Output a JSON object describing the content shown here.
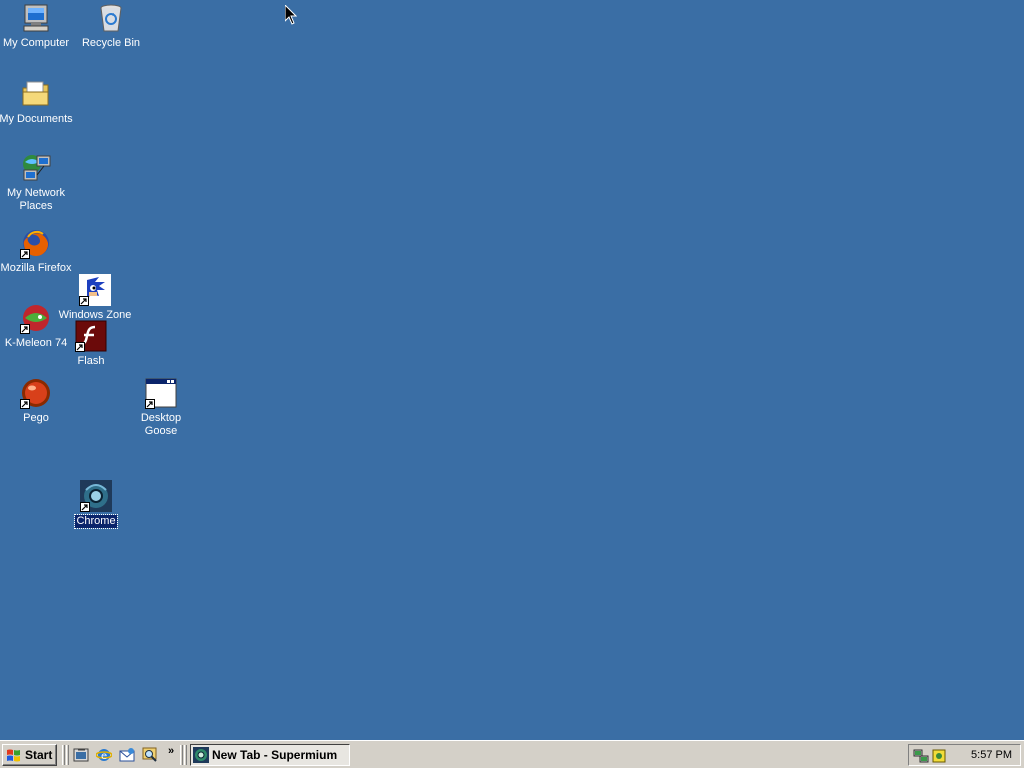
{
  "desktop": {
    "background": "#3a6ea5",
    "icons": [
      {
        "label": "My Computer",
        "icon": "computer-icon"
      },
      {
        "label": "Recycle Bin",
        "icon": "recycle-bin-icon"
      },
      {
        "label": "My Documents",
        "icon": "folder-icon"
      },
      {
        "label": "My Network Places",
        "icon": "network-icon"
      },
      {
        "label": "Mozilla Firefox",
        "icon": "firefox-icon"
      },
      {
        "label": "Windows Zone",
        "icon": "sonic-icon"
      },
      {
        "label": "K-Meleon 74",
        "icon": "k-meleon-icon"
      },
      {
        "label": "Flash",
        "icon": "flash-icon"
      },
      {
        "label": "Pego",
        "icon": "pego-icon"
      },
      {
        "label": "Desktop Goose",
        "icon": "window-icon"
      },
      {
        "label": "Chrome",
        "icon": "chrome-icon",
        "selected": true
      }
    ]
  },
  "taskbar": {
    "start_label": "Start",
    "quick_launch": [
      "show-desktop-icon",
      "internet-explorer-icon",
      "outlook-express-icon",
      "search-icon"
    ],
    "more_label": "»",
    "tasks": [
      {
        "label": "New Tab - Supermium",
        "icon": "supermium-icon"
      }
    ],
    "tray_icons": [
      "network-tray-icon",
      "security-tray-icon"
    ],
    "clock": "5:57 PM"
  }
}
